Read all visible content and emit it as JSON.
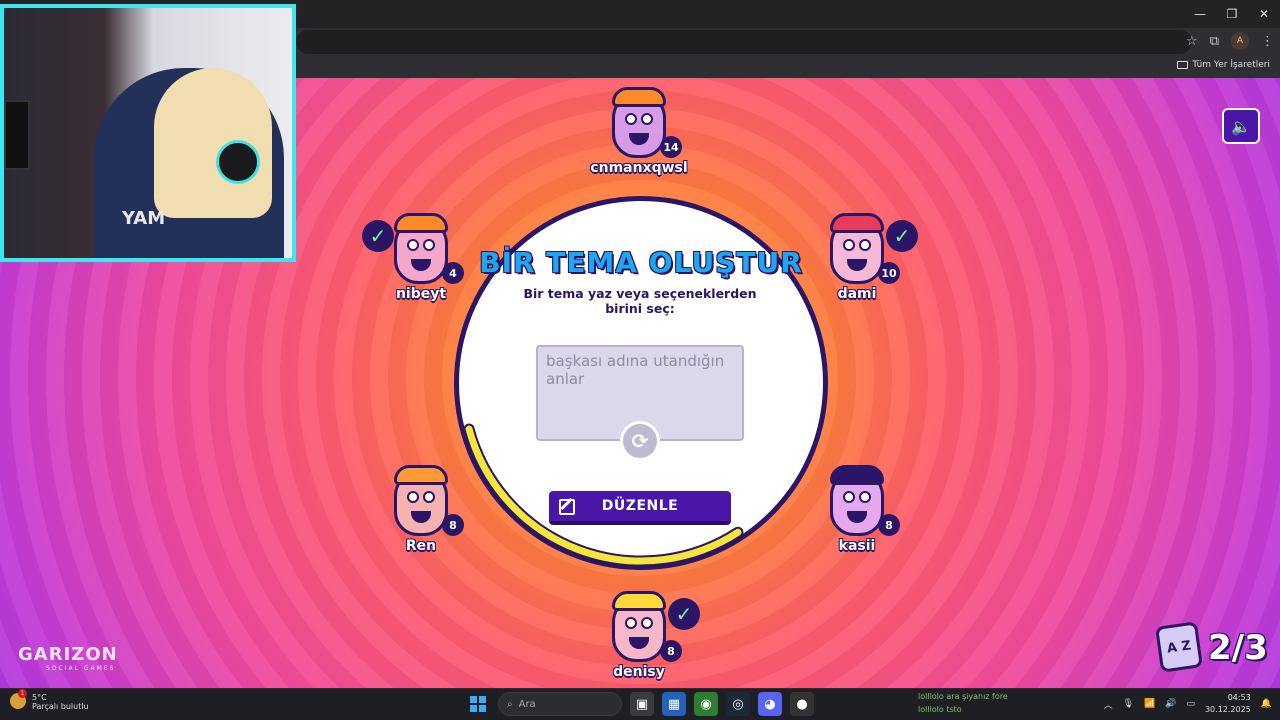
{
  "browser": {
    "window_controls": [
      "—",
      "❐",
      "✕"
    ],
    "avatar_letter": "A",
    "bookmarks_label": "Tüm Yer İşaretleri"
  },
  "game": {
    "panel": {
      "title": "BİR TEMA OLUŞTUR",
      "subtitle": "Bir tema yaz veya seçeneklerden birini seç:",
      "theme_text": "başkası adına utandığın anlar",
      "edit_label": "DÜZENLE"
    },
    "timer_remaining": 0.4,
    "players": [
      {
        "name": "cnmanxqwsl",
        "score": "14",
        "checked": false,
        "face": "#d89be8",
        "hair": "#ff8a2a"
      },
      {
        "name": "nibeyt",
        "score": "4",
        "checked": true,
        "face": "#f4a7c9",
        "hair": "#ff8a2a"
      },
      {
        "name": "dami",
        "score": "10",
        "checked": true,
        "face": "#f6b8d4",
        "hair": "#e83a5a"
      },
      {
        "name": "Ren",
        "score": "8",
        "checked": false,
        "face": "#f6b2b0",
        "hair": "#ff9a3a"
      },
      {
        "name": "kasii",
        "score": "8",
        "checked": false,
        "face": "#e5a8ec",
        "hair": "#2a1566"
      },
      {
        "name": "denisy",
        "score": "8",
        "checked": true,
        "face": "#f8b7c6",
        "hair": "#ffd93a"
      }
    ],
    "round": "2/3",
    "round_icon_text": "A Z",
    "logo": {
      "brand": "GARIZON",
      "tagline": "SOCIAL GAMES"
    }
  },
  "webcam": {
    "shirt_text": "YAM"
  },
  "taskbar": {
    "weather_temp": "5°C",
    "weather_desc": "Parçalı bulutlu",
    "weather_badge": "1",
    "search_placeholder": "Ara",
    "chat_line1": "lolllolo ara şiyanız fore",
    "chat_line2": "lolllolo tsto",
    "time": "04:53",
    "date": "30.12.2025"
  },
  "colors": {
    "accent": "#4a16a8",
    "outline": "#2a1566",
    "title_blue": "#1ea6ee",
    "timer": "#f6e53a"
  }
}
